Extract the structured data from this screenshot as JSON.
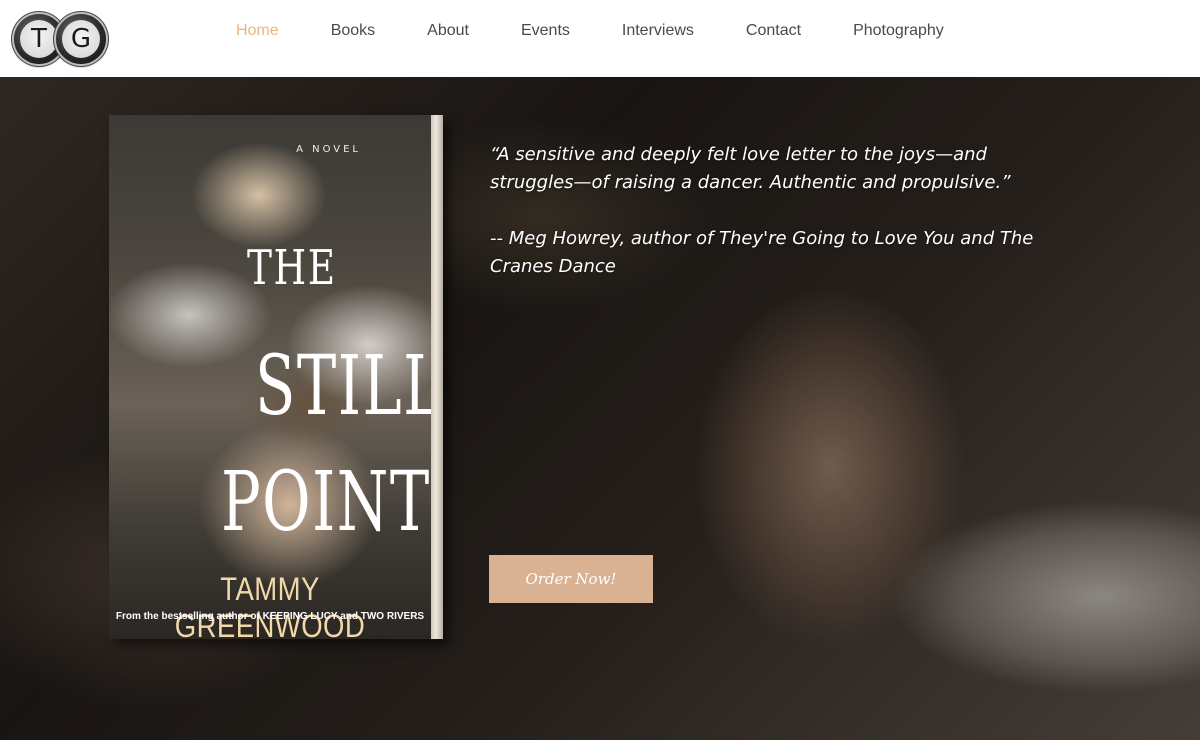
{
  "header": {
    "logo": {
      "left_letter": "T",
      "right_letter": "G"
    },
    "nav": {
      "items": [
        {
          "label": "Home",
          "active": true
        },
        {
          "label": "Books"
        },
        {
          "label": "About"
        },
        {
          "label": "Events"
        },
        {
          "label": "Interviews"
        },
        {
          "label": "Contact"
        },
        {
          "label": "Photography"
        }
      ],
      "active_color": "#e8b97e",
      "color": "#4a4a4a"
    }
  },
  "hero": {
    "book": {
      "novel_label": "A NOVEL",
      "title_lines": [
        "THE",
        "STILL",
        "POINT"
      ],
      "author": "TAMMY GREENWOOD",
      "tagline": "From the bestselling author of KEEPING LUCY and TWO RIVERS"
    },
    "quote": {
      "text": "“A sensitive and deeply felt love letter to the joys—and struggles—of raising a dancer. Authentic and propulsive.”",
      "attribution": "-- Meg Howrey, author of They're Going to Love You and The Cranes Dance"
    },
    "order_button": {
      "label": "Order Now!",
      "color": "#d9b294"
    }
  }
}
